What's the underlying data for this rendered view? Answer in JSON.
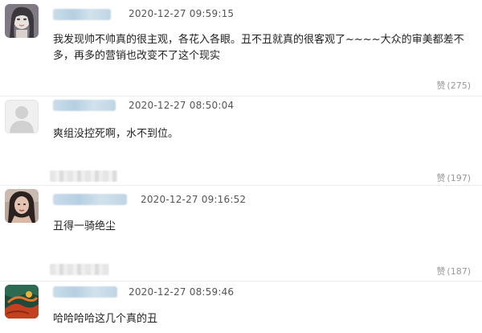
{
  "comments": [
    {
      "timestamp": "2020-12-27 09:59:15",
      "text": "我发现帅不帅真的很主观，各花入各眼。丑不丑就真的很客观了~~~~大众的审美都差不多，再多的营销也改变不了这个现实",
      "like_label": "赞",
      "likes": "(275)"
    },
    {
      "timestamp": "2020-12-27 08:50:04",
      "text": "爽组没控死啊，水不到位。",
      "like_label": "赞",
      "likes": "(197)"
    },
    {
      "timestamp": "2020-12-27 09:16:52",
      "text": "丑得一骑绝尘",
      "like_label": "赞",
      "likes": "(187)"
    },
    {
      "timestamp": "2020-12-27 08:59:46",
      "text": "哈哈哈哈这几个真的丑"
    }
  ]
}
